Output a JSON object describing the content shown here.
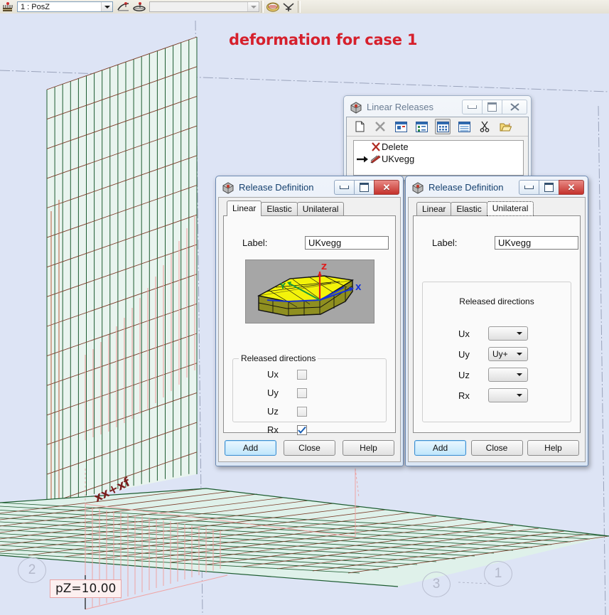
{
  "toolbar": {
    "icons": [
      "support-icon",
      "load-case-icon",
      "bar-support-icon",
      "panel-support-icon",
      "colors-icon",
      "section-icon"
    ],
    "case_combo": {
      "value": "1 : PosZ",
      "placeholder": ""
    },
    "second_combo": {
      "value": "",
      "placeholder": ""
    }
  },
  "canvas": {
    "caption": "deformation for case 1",
    "load_label": "pZ=10.00",
    "axis_label": "xx+xf",
    "grid_bubbles": [
      "2",
      "3",
      "1"
    ]
  },
  "linear_releases_window": {
    "title": "Linear Releases",
    "title_icon": "release-cube-icon",
    "controls": {
      "minimize": "minimize-button",
      "maximize": "maximize-button",
      "close": "close-button"
    },
    "toolbar_buttons": [
      {
        "name": "new-icon",
        "label": "New"
      },
      {
        "name": "delete-x-icon",
        "label": "Delete"
      },
      {
        "name": "large-icons-view-icon",
        "label": "Large icons"
      },
      {
        "name": "small-icons-view-icon",
        "label": "Small icons"
      },
      {
        "name": "list-view-icon",
        "label": "List"
      },
      {
        "name": "details-view-icon",
        "label": "Details"
      },
      {
        "name": "scissors-icon",
        "label": "Cut"
      },
      {
        "name": "open-folder-icon",
        "label": "Open"
      }
    ],
    "list_items": [
      {
        "icon": "delete-x-icon",
        "label": "Delete",
        "selected": false
      },
      {
        "icon": "release-pen-icon",
        "label": "UKvegg",
        "selected": true
      }
    ]
  },
  "dialog_left": {
    "title": "Release Definition",
    "title_icon": "release-cube-icon",
    "tabs": [
      {
        "label": "Linear",
        "state": "active"
      },
      {
        "label": "Elastic",
        "state": "normal"
      },
      {
        "label": "Unilateral",
        "state": "normal"
      }
    ],
    "label_caption": "Label:",
    "label_value": "UKvegg",
    "preview_icon": "curved-slab-3d-preview",
    "preview_axes": [
      "Z",
      "X",
      "Y"
    ],
    "group_title": "Released directions",
    "directions": [
      {
        "name": "Ux",
        "checked": false
      },
      {
        "name": "Uy",
        "checked": false
      },
      {
        "name": "Uz",
        "checked": false
      },
      {
        "name": "Rx",
        "checked": true
      }
    ],
    "buttons": [
      {
        "label": "Add",
        "default": true
      },
      {
        "label": "Close",
        "default": false
      },
      {
        "label": "Help",
        "default": false
      }
    ]
  },
  "dialog_right": {
    "title": "Release Definition",
    "title_icon": "release-cube-icon",
    "tabs": [
      {
        "label": "Linear",
        "state": "normal"
      },
      {
        "label": "Elastic",
        "state": "normal"
      },
      {
        "label": "Unilateral",
        "state": "focus"
      }
    ],
    "label_caption": "Label:",
    "label_value": "UKvegg",
    "group_title": "Released directions",
    "directions": [
      {
        "name": "Ux",
        "value": ""
      },
      {
        "name": "Uy",
        "value": "Uy+"
      },
      {
        "name": "Uz",
        "value": ""
      },
      {
        "name": "Rx",
        "value": ""
      }
    ],
    "buttons": [
      {
        "label": "Add",
        "default": true
      },
      {
        "label": "Close",
        "default": false
      },
      {
        "label": "Help",
        "default": false
      }
    ]
  },
  "colors": {
    "caption_red": "#d6202c",
    "canvas_bg": "#dde4f5",
    "mesh_green": "#1d5c31",
    "mesh_fill": "#daf0e6",
    "support_pink": "#f0a3a3",
    "accent_blue": "#3c8fd0"
  }
}
